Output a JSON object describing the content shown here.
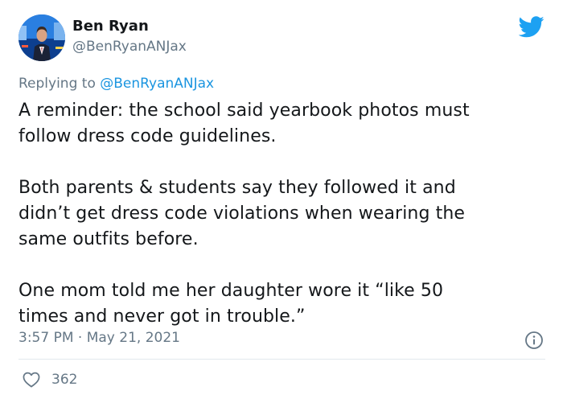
{
  "author": {
    "name": "Ben Ryan",
    "handle": "@BenRyanANJax",
    "avatar_icon": "news-anchor-avatar"
  },
  "brand": {
    "icon": "twitter-bird-icon",
    "color": "#1da1f2"
  },
  "reply": {
    "prefix": "Replying to",
    "mention": "@BenRyanANJax"
  },
  "tweet": {
    "paragraphs": [
      "A reminder: the school said yearbook photos must\nfollow dress code guidelines.",
      "Both parents & students say they followed it and\ndidn’t get dress code violations when wearing the\nsame outfits before.",
      "One mom told me her daughter wore it “like 50\ntimes and never got in trouble.”"
    ]
  },
  "meta": {
    "timestamp": "3:57 PM · May 21, 2021",
    "info_icon": "info-icon"
  },
  "engagement": {
    "like_icon": "heart-icon",
    "like_count": "362"
  },
  "colors": {
    "text": "#14171a",
    "secondary": "#657786",
    "link": "#1b95e0",
    "divider": "#e1e8ed"
  }
}
